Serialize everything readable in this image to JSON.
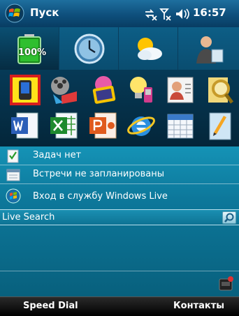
{
  "titlebar": {
    "start_label": "Пуск",
    "time": "16:57",
    "icons": [
      "start-flag-icon",
      "connectivity-icon",
      "signal-off-icon",
      "volume-icon"
    ]
  },
  "tabs": [
    {
      "name": "battery",
      "icon": "battery-icon",
      "label": "100%",
      "selected": true
    },
    {
      "name": "clock",
      "icon": "clock-icon",
      "selected": false
    },
    {
      "name": "weather",
      "icon": "weather-icon",
      "selected": false
    },
    {
      "name": "contacts",
      "icon": "contacts-icon",
      "selected": false
    }
  ],
  "launcher": {
    "row1": [
      "pda-icon",
      "media-icon",
      "photos-icon",
      "tips-icon",
      "contacts-card-icon",
      "search-icon"
    ],
    "row2": [
      "word-icon",
      "excel-icon",
      "powerpoint-icon",
      "internet-explorer-icon",
      "calendar-icon",
      "notes-icon"
    ]
  },
  "today": {
    "tasks": "Задач нет",
    "appointments": "Встречи не запланированы",
    "live_signin": "Вход в службу Windows Live",
    "search_label": "Live Search"
  },
  "softkeys": {
    "left": "Speed Dial",
    "right": "Контакты"
  },
  "colors": {
    "titlebar": "#0e4f7c",
    "today_bg": "#0d789b",
    "softkey_bg": "#000000"
  }
}
